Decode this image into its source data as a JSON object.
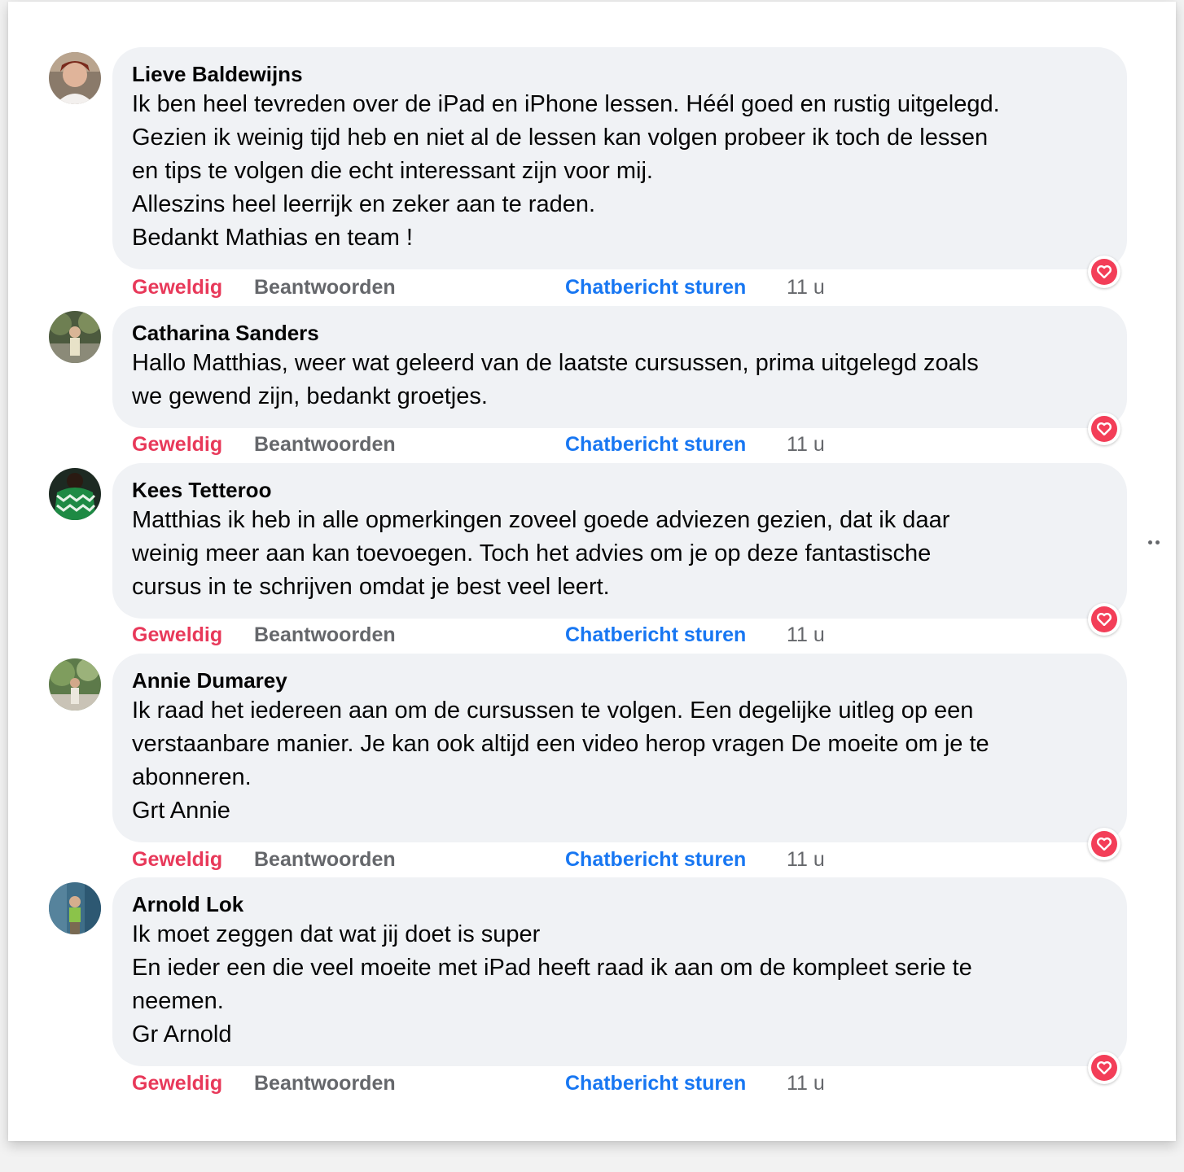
{
  "actions": {
    "like": "Geweldig",
    "reply": "Beantwoorden",
    "chat": "Chatbericht sturen"
  },
  "reaction_icon": "heart-love-reaction",
  "colors": {
    "like": "#e8395a",
    "chat": "#1877f2",
    "muted": "#65676b",
    "bubble": "#f0f2f5",
    "reaction": "#f33e58"
  },
  "comments": [
    {
      "author": "Lieve Baldewijns",
      "lines": [
        "Ik ben heel tevreden over de iPad en iPhone lessen. Héél goed en rustig uitgelegd.",
        "Gezien ik weinig tijd heb en niet al de lessen kan volgen probeer ik toch de lessen",
        "en tips te volgen die echt interessant zijn voor mij.",
        "Alleszins heel leerrijk en zeker aan te raden.",
        "Bedankt Mathias en team !"
      ],
      "time": "11 u"
    },
    {
      "author": "Catharina Sanders",
      "lines": [
        "Hallo Matthias, weer wat geleerd van de laatste cursussen, prima uitgelegd zoals",
        "we gewend zijn, bedankt groetjes."
      ],
      "time": "11 u"
    },
    {
      "author": "Kees Tetteroo",
      "lines": [
        "Matthias ik heb in alle opmerkingen zoveel goede adviezen gezien, dat ik daar",
        "weinig meer aan kan toevoegen. Toch het advies om je op deze fantastische",
        "cursus in te schrijven omdat je best veel leert."
      ],
      "time": "11 u"
    },
    {
      "author": "Annie Dumarey",
      "lines": [
        "Ik raad het iedereen aan om de cursussen te volgen. Een degelijke uitleg op een",
        "verstaanbare manier. Je kan ook altijd een video herop vragen De moeite om je te",
        "abonneren.",
        "Grt Annie"
      ],
      "time": "11 u"
    },
    {
      "author": "Arnold Lok",
      "lines": [
        "Ik moet zeggen dat wat jij doet is super",
        "En ieder een die veel moeite met iPad heeft raad ik aan om de kompleet serie te",
        "neemen.",
        "Gr Arnold"
      ],
      "time": "11 u"
    }
  ]
}
